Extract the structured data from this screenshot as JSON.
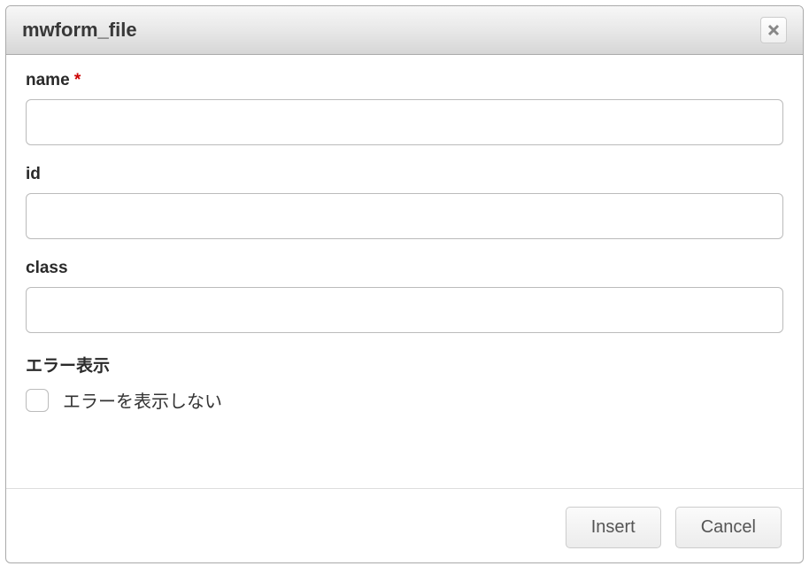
{
  "dialog": {
    "title": "mwform_file"
  },
  "fields": {
    "name": {
      "label": "name",
      "required_marker": "*",
      "value": ""
    },
    "id": {
      "label": "id",
      "value": ""
    },
    "class": {
      "label": "class",
      "value": ""
    },
    "error_display": {
      "label": "エラー表示",
      "checkbox_label": "エラーを表示しない",
      "checked": false
    }
  },
  "buttons": {
    "insert": "Insert",
    "cancel": "Cancel"
  }
}
